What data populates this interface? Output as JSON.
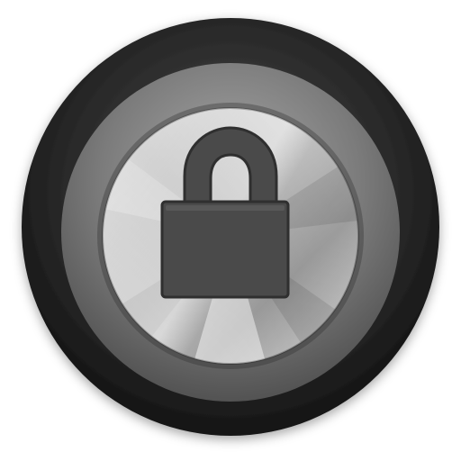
{
  "icon": {
    "name": "lock-icon",
    "state": "locked"
  },
  "colors": {
    "background": "#ffffff",
    "outer_ring_dark": "#1f1f1f",
    "outer_ring_mid": "#3a3a3a",
    "middle_ring": "#7a7a7a",
    "metal_face_light": "#f2f2f2",
    "metal_face_dark": "#8a8a8a",
    "lock_fill": "#4a4a4a",
    "lock_edge": "#2f2f2f"
  }
}
